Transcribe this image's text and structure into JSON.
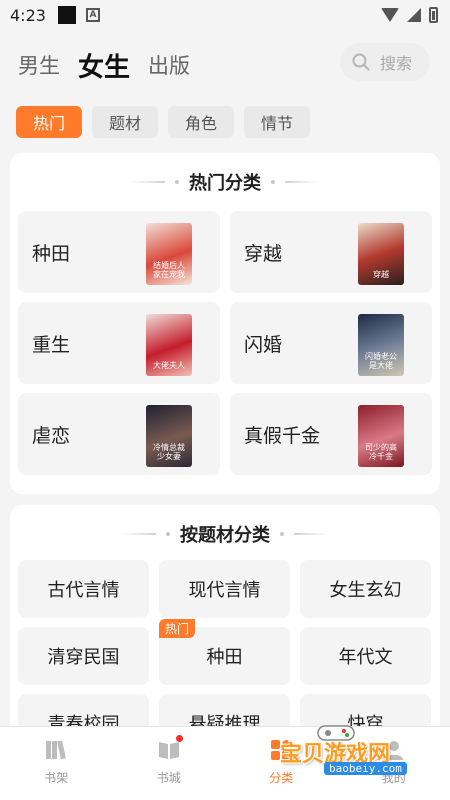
{
  "status": {
    "time": "4:23",
    "a_icon": "A"
  },
  "topnav": {
    "tabs": [
      "男生",
      "女生",
      "出版"
    ],
    "active": "女生"
  },
  "search": {
    "placeholder": "搜索"
  },
  "chips": [
    "热门",
    "题材",
    "角色",
    "情节"
  ],
  "hot_section": {
    "title": "热门分类",
    "items": [
      {
        "label": "种田",
        "cover_text": "结婚后人家在宠我"
      },
      {
        "label": "穿越",
        "cover_text": "穿越"
      },
      {
        "label": "重生",
        "cover_text": "大佬夫人"
      },
      {
        "label": "闪婚",
        "cover_text": "闪婚老公是大佬"
      },
      {
        "label": "虐恋",
        "cover_text": "冷情总裁少女妻"
      },
      {
        "label": "真假千金",
        "cover_text": "司少的高冷千金"
      }
    ]
  },
  "theme_section": {
    "title": "按题材分类",
    "items": [
      "古代言情",
      "现代言情",
      "女生玄幻",
      "清穿民国",
      "种田",
      "年代文",
      "青春校园",
      "悬疑推理",
      "快穿"
    ],
    "hot_tag": "热门"
  },
  "bottomnav": {
    "items": [
      "书架",
      "书城",
      "分类",
      "我的"
    ],
    "active": "分类"
  },
  "watermark": {
    "text": "宝贝游戏网",
    "url": "baobeiy.com"
  }
}
